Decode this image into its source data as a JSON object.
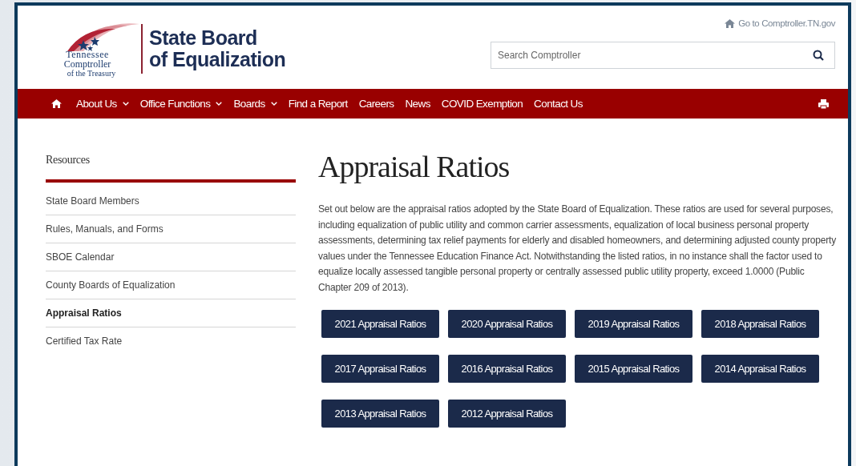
{
  "logo": {
    "lines": [
      "Tennessee",
      "Comptroller",
      "of the Treasury"
    ]
  },
  "site_title": [
    "State Board",
    "of Equalization"
  ],
  "top_link": "Go to Comptroller.TN.gov",
  "search": {
    "placeholder": "Search Comptroller"
  },
  "nav": [
    {
      "label": "About Us",
      "dropdown": true
    },
    {
      "label": "Office Functions",
      "dropdown": true
    },
    {
      "label": "Boards",
      "dropdown": true
    },
    {
      "label": "Find a Report",
      "dropdown": false
    },
    {
      "label": "Careers",
      "dropdown": false
    },
    {
      "label": "News",
      "dropdown": false
    },
    {
      "label": "COVID Exemption",
      "dropdown": false
    },
    {
      "label": "Contact Us",
      "dropdown": false
    }
  ],
  "sidebar": {
    "title": "Resources",
    "items": [
      {
        "label": "State Board Members",
        "selected": false
      },
      {
        "label": "Rules, Manuals, and Forms",
        "selected": false
      },
      {
        "label": "SBOE Calendar",
        "selected": false
      },
      {
        "label": "County Boards of Equalization",
        "selected": false
      },
      {
        "label": "Appraisal Ratios",
        "selected": true
      },
      {
        "label": "Certified Tax Rate",
        "selected": false
      }
    ]
  },
  "page_title": "Appraisal Ratios",
  "intro": "Set out below are the appraisal ratios adopted by the State Board of Equalization. These ratios are used for several purposes, including equalization of public utility and common carrier assessments, equalization of local business personal property assessments, determining tax relief payments for elderly and disabled homeowners, and determining adjusted county property values under the Tennessee Education Finance Act. Notwithstanding the listed ratios, in no instance shall the factor used to equalize locally assessed tangible personal property or centrally assessed public utility property, exceed 1.0000 (Public Chapter 209 of 2013).",
  "buttons": [
    "2021 Appraisal Ratios",
    "2020 Appraisal Ratios",
    "2019 Appraisal Ratios",
    "2018 Appraisal Ratios",
    "2017 Appraisal Ratios",
    "2016 Appraisal Ratios",
    "2015 Appraisal Ratios",
    "2014 Appraisal Ratios",
    "2013 Appraisal Ratios",
    "2012 Appraisal Ratios"
  ]
}
